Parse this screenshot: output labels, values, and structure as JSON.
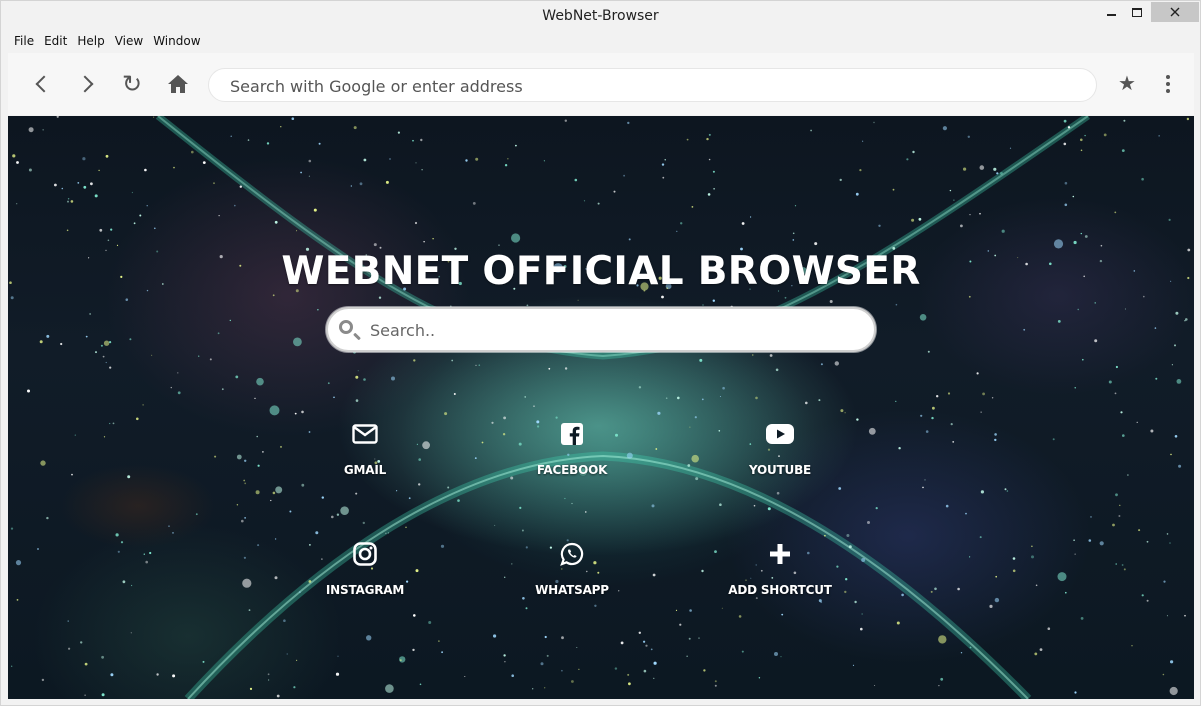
{
  "window": {
    "title": "WebNet-Browser"
  },
  "menu": {
    "items": [
      "File",
      "Edit",
      "Help",
      "View",
      "Window"
    ]
  },
  "toolbar": {
    "address_placeholder": "Search with Google or enter address",
    "icons": {
      "back": "chevron-left-icon",
      "forward": "chevron-right-icon",
      "reload": "reload-icon",
      "home": "home-icon",
      "bookmark": "star-icon",
      "menu": "kebab-menu-icon"
    }
  },
  "page": {
    "title": "WEBNET OFFICIAL BROWSER",
    "search_placeholder": "Search..",
    "shortcuts": [
      {
        "label": "GMAIL",
        "icon": "envelope-icon"
      },
      {
        "label": "FACEBOOK",
        "icon": "facebook-icon"
      },
      {
        "label": "YOUTUBE",
        "icon": "youtube-icon"
      },
      {
        "label": "INSTAGRAM",
        "icon": "instagram-icon"
      },
      {
        "label": "WHATSAPP",
        "icon": "whatsapp-icon"
      },
      {
        "label": "ADD SHORTCUT",
        "icon": "plus-icon"
      }
    ]
  },
  "colors": {
    "chrome_bg": "#f2f2f2",
    "toolbar_bg": "#f7f7f7",
    "close_button": "#c7c7c7",
    "page_text": "#ffffff",
    "space_bg": "#0d1620",
    "nebula_glow": "#3fd0b0"
  }
}
